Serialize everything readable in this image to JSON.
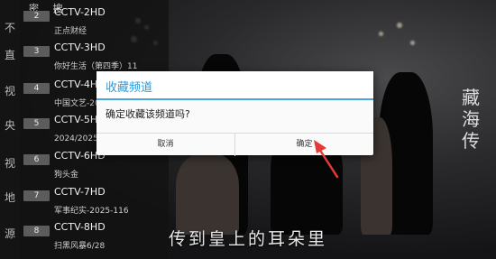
{
  "categories": [
    "不",
    "直",
    "视",
    "央",
    "视",
    "地",
    "源"
  ],
  "top_icons": "密 搜",
  "channels": [
    {
      "num": "2",
      "name": "CCTV-2HD",
      "program": "正点财经"
    },
    {
      "num": "3",
      "name": "CCTV-3HD",
      "program": "你好生活（第四季）11"
    },
    {
      "num": "4",
      "name": "CCTV-4HD",
      "program": "中国文艺-20"
    },
    {
      "num": "5",
      "name": "CCTV-5HD",
      "program": "2024/2025赛"
    },
    {
      "num": "6",
      "name": "CCTV-6HD",
      "program": "狗头金"
    },
    {
      "num": "7",
      "name": "CCTV-7HD",
      "program": "军事纪实-2025-116"
    },
    {
      "num": "8",
      "name": "CCTV-8HD",
      "program": "扫黑风暴6/28"
    }
  ],
  "video": {
    "calligraphy": "藏海传",
    "subtitle": "传到皇上的耳朵里"
  },
  "dialog": {
    "title": "收藏频道",
    "message": "确定收藏该频道吗?",
    "cancel_label": "取消",
    "ok_label": "确定"
  },
  "colors": {
    "dialog_accent": "#2b9bd6",
    "arrow": "#e53935",
    "channel_badge": "#5c5c5c"
  }
}
